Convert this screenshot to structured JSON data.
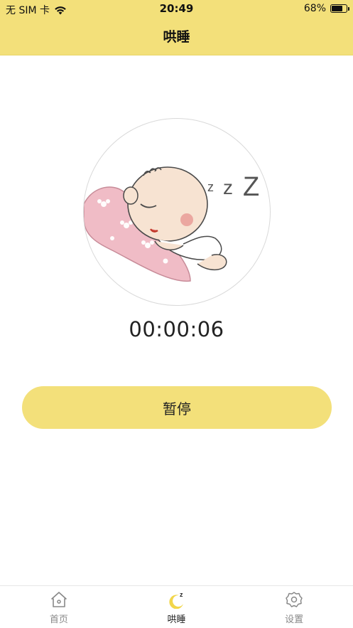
{
  "status_bar": {
    "carrier": "无 SIM 卡",
    "time": "20:49",
    "battery_percent": "68%",
    "battery_level": 0.68,
    "wifi_icon": "wifi-icon",
    "battery_icon": "battery-icon"
  },
  "nav": {
    "title": "哄睡"
  },
  "main": {
    "illustration": "sleeping-baby-illustration",
    "timer": "00:00:06",
    "pause_label": "暂停"
  },
  "tabs": [
    {
      "label": "首页",
      "icon": "home-icon",
      "active": false
    },
    {
      "label": "哄睡",
      "icon": "moon-icon",
      "active": true
    },
    {
      "label": "设置",
      "icon": "settings-icon",
      "active": false
    }
  ],
  "colors": {
    "accent": "#F3E07A",
    "moon": "#F2D64B",
    "tab_inactive": "#888888"
  }
}
